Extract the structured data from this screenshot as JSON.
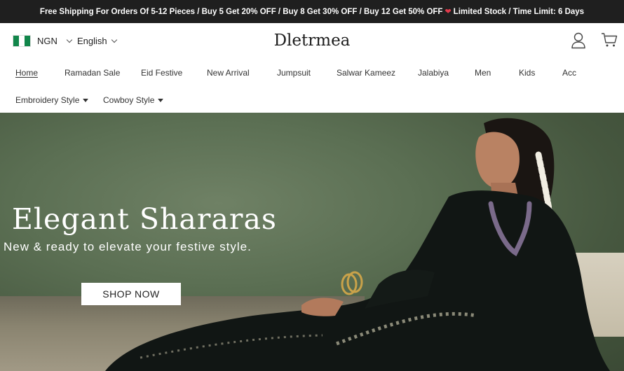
{
  "announcement": {
    "text_before": "Free Shipping For Orders Of 5-12 Pieces / Buy 5 Get 20% OFF / Buy 8 Get 30% OFF / Buy 12 Get 50% OFF",
    "heart_icon": "broken-heart-icon",
    "text_after": "Limited Stock / Time Limit: 6 Days"
  },
  "header": {
    "currency": "NGN",
    "language": "English",
    "logo": "Dletrmea",
    "flag_colors": [
      "#12864b",
      "#ffffff",
      "#12864b"
    ],
    "icons": [
      "user-icon",
      "cart-icon"
    ]
  },
  "nav": {
    "items": [
      {
        "label": "Home",
        "active": true
      },
      {
        "label": "Ramadan Sale"
      },
      {
        "label": "Eid Festive"
      },
      {
        "label": "New Arrival"
      },
      {
        "label": "Jumpsuit"
      },
      {
        "label": "Salwar Kameez"
      },
      {
        "label": "Jalabiya"
      },
      {
        "label": "Men"
      },
      {
        "label": "Kids"
      },
      {
        "label": "Acc"
      },
      {
        "label": "Embroidery Style",
        "dropdown": true
      },
      {
        "label": "Cowboy Style",
        "dropdown": true
      }
    ]
  },
  "hero": {
    "title": "Elegant Shararas",
    "subtitle": "New & ready to elevate your festive style.",
    "button": "SHOP NOW"
  }
}
